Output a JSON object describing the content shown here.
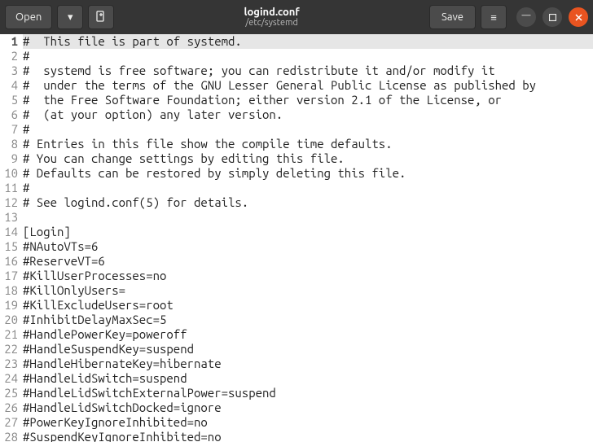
{
  "header": {
    "open_label": "Open",
    "save_label": "Save",
    "title": "logind.conf",
    "subtitle": "/etc/systemd"
  },
  "icons": {
    "chevron_down": "▾",
    "new_tab": "⎙",
    "menu": "≡",
    "minimize": "—",
    "maximize": "▢",
    "close": "✕"
  },
  "editor": {
    "current_line": 1,
    "lines": [
      "#  This file is part of systemd.",
      "#",
      "#  systemd is free software; you can redistribute it and/or modify it",
      "#  under the terms of the GNU Lesser General Public License as published by",
      "#  the Free Software Foundation; either version 2.1 of the License, or",
      "#  (at your option) any later version.",
      "#",
      "# Entries in this file show the compile time defaults.",
      "# You can change settings by editing this file.",
      "# Defaults can be restored by simply deleting this file.",
      "#",
      "# See logind.conf(5) for details.",
      "",
      "[Login]",
      "#NAutoVTs=6",
      "#ReserveVT=6",
      "#KillUserProcesses=no",
      "#KillOnlyUsers=",
      "#KillExcludeUsers=root",
      "#InhibitDelayMaxSec=5",
      "#HandlePowerKey=poweroff",
      "#HandleSuspendKey=suspend",
      "#HandleHibernateKey=hibernate",
      "#HandleLidSwitch=suspend",
      "#HandleLidSwitchExternalPower=suspend",
      "#HandleLidSwitchDocked=ignore",
      "#PowerKeyIgnoreInhibited=no",
      "#SuspendKeyIgnoreInhibited=no"
    ]
  }
}
